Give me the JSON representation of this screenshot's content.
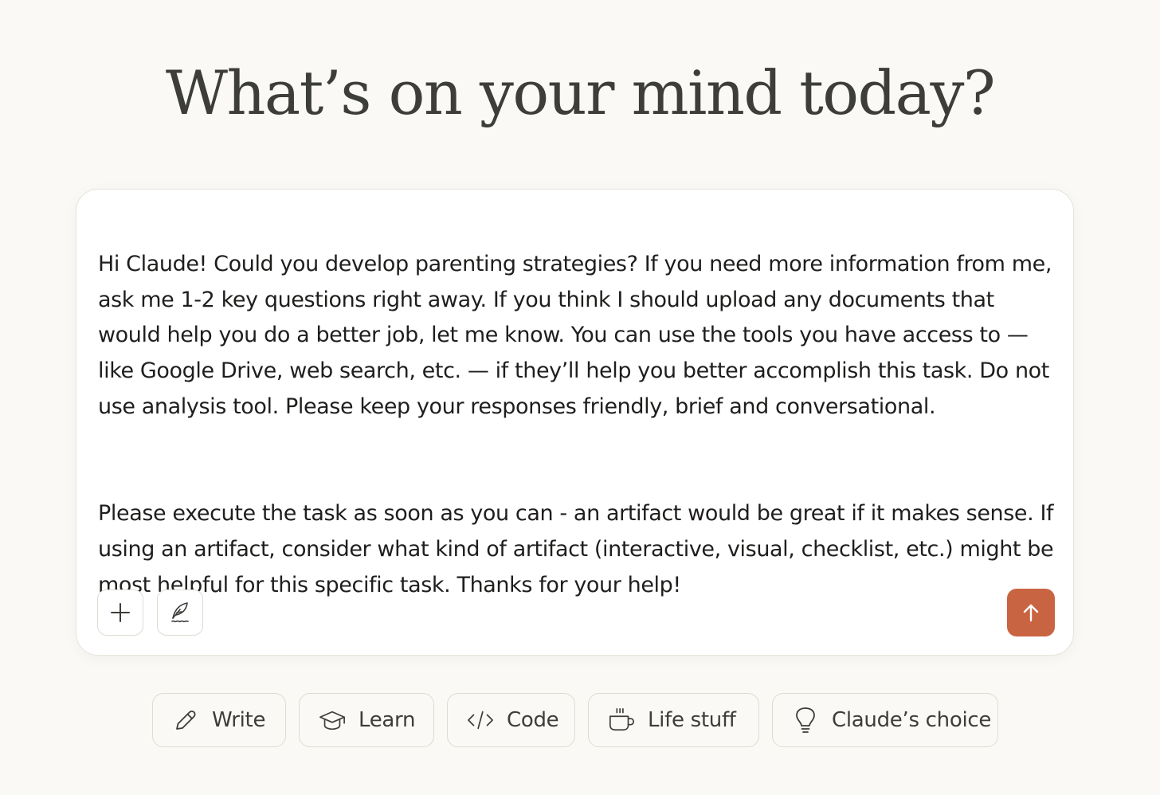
{
  "heading": "What’s on your mind today?",
  "composer": {
    "paragraphs": [
      "Hi Claude! Could you develop parenting strategies? If you need more information from me, ask me 1-2 key questions right away. If you think I should upload any documents that would help you do a better job, let me know. You can use the tools you have access to — like Google Drive, web search, etc. — if they’ll help you better accomplish this task. Do not use analysis tool. Please keep your responses friendly, brief and conversational.",
      "Please execute the task as soon as you can - an artifact would be great if it makes sense. If using an artifact, consider what kind of artifact (interactive, visual, checklist, etc.) might be most helpful for this specific task. Thanks for your help!"
    ],
    "add_icon": "plus-icon",
    "style_icon": "quill-icon",
    "send_icon": "arrow-up-icon",
    "send_color": "#c96442"
  },
  "chips": [
    {
      "label": "Write",
      "icon": "pencil-icon"
    },
    {
      "label": "Learn",
      "icon": "graduation-cap-icon"
    },
    {
      "label": "Code",
      "icon": "code-icon"
    },
    {
      "label": "Life stuff",
      "icon": "coffee-cup-icon"
    },
    {
      "label": "Claude’s choice",
      "icon": "lightbulb-icon"
    }
  ]
}
